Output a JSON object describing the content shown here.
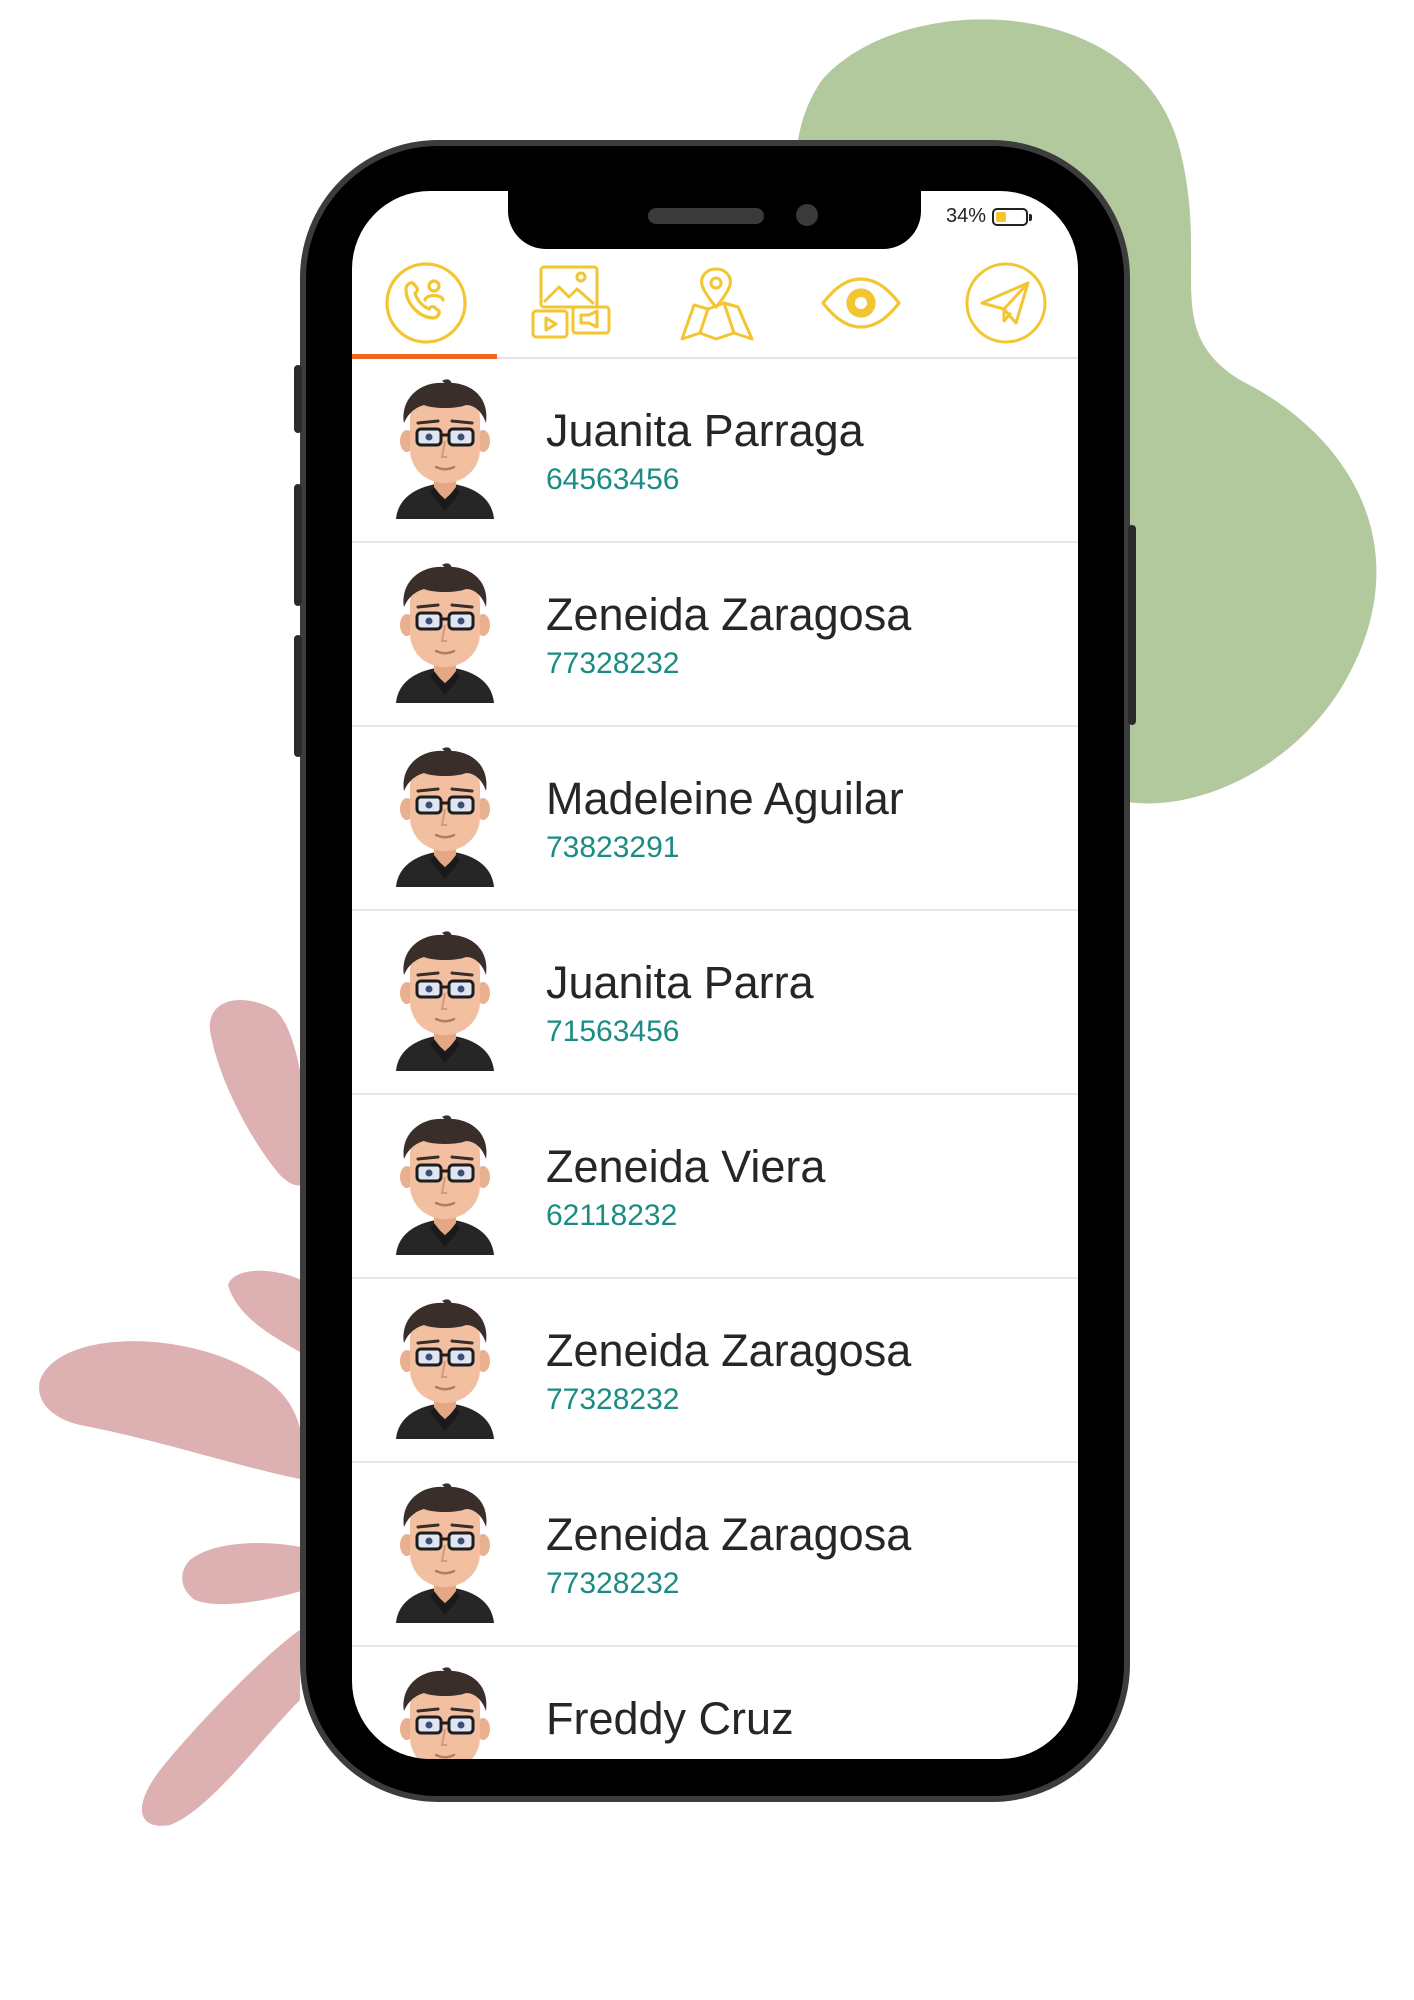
{
  "status_bar": {
    "battery_percent": "34%",
    "battery_level": 0.34
  },
  "tabs": [
    {
      "name": "calls-tab",
      "icon": "phone-contact-icon",
      "active": true
    },
    {
      "name": "media-tab",
      "icon": "media-gallery-icon",
      "active": false
    },
    {
      "name": "map-tab",
      "icon": "map-location-icon",
      "active": false
    },
    {
      "name": "view-tab",
      "icon": "eye-icon",
      "active": false
    },
    {
      "name": "send-tab",
      "icon": "paper-plane-icon",
      "active": false
    }
  ],
  "colors": {
    "accent_icon": "#f2c531",
    "active_tab_indicator": "#f26522",
    "phone_number": "#1b8c84",
    "blob_green": "#b2c99e",
    "blob_pink": "#ddb0b1"
  },
  "contacts": [
    {
      "name": "Juanita Parraga",
      "phone": "64563456"
    },
    {
      "name": "Zeneida Zaragosa",
      "phone": "77328232"
    },
    {
      "name": "Madeleine Aguilar",
      "phone": "73823291"
    },
    {
      "name": "Juanita Parra",
      "phone": "71563456"
    },
    {
      "name": "Zeneida Viera",
      "phone": "62118232"
    },
    {
      "name": "Zeneida Zaragosa",
      "phone": "77328232"
    },
    {
      "name": "Zeneida Zaragosa",
      "phone": "77328232"
    },
    {
      "name": "Freddy Cruz",
      "phone": ""
    }
  ]
}
